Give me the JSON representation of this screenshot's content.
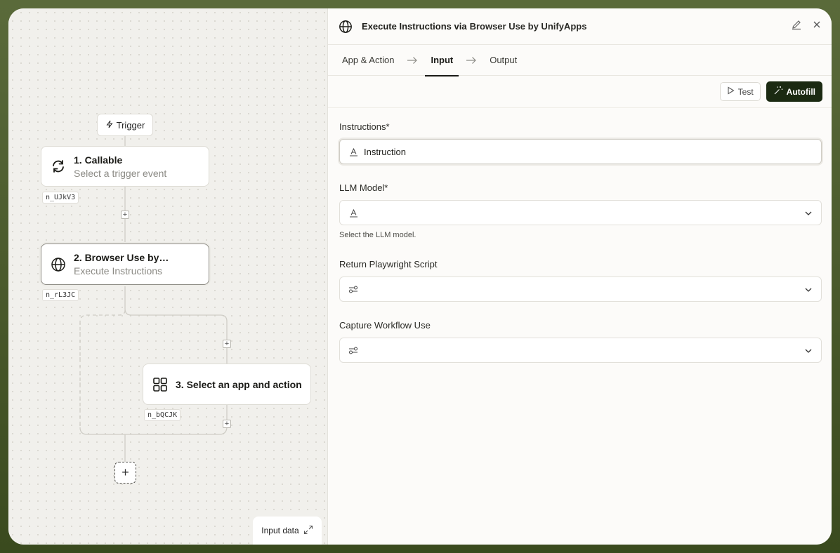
{
  "canvas": {
    "trigger_label": "Trigger",
    "nodes": [
      {
        "title": "1. Callable",
        "subtitle": "Select a trigger event",
        "id": "n_UJkV3",
        "icon": "refresh-icon"
      },
      {
        "title": "2. Browser Use by…",
        "subtitle": "Execute Instructions",
        "id": "n_rL3JC",
        "icon": "globe-icon"
      },
      {
        "title": "3. Select an app and action",
        "subtitle": "",
        "id": "n_bQCJK",
        "icon": "grid-icon"
      }
    ],
    "input_data_label": "Input data"
  },
  "panel": {
    "title": "Execute Instructions via",
    "app_name": "Browser Use by UnifyApps",
    "tabs": [
      {
        "label": "App & Action"
      },
      {
        "label": "Input"
      },
      {
        "label": "Output"
      }
    ],
    "active_tab": "Input",
    "test_label": "Test",
    "autofill_label": "Autofill",
    "fields": [
      {
        "label": "Instructions*",
        "value": "Instruction",
        "icon": "text-icon"
      },
      {
        "label": "LLM Model*",
        "value": "",
        "icon": "text-icon",
        "hint": "Select the LLM model."
      },
      {
        "label": "Return Playwright Script",
        "value": "",
        "icon": "toggle-icon"
      },
      {
        "label": "Capture Workflow Use",
        "value": "",
        "icon": "toggle-icon"
      }
    ]
  },
  "colors": {
    "accent": "#1b2a12",
    "frame_bg": "#4a5a2c"
  }
}
